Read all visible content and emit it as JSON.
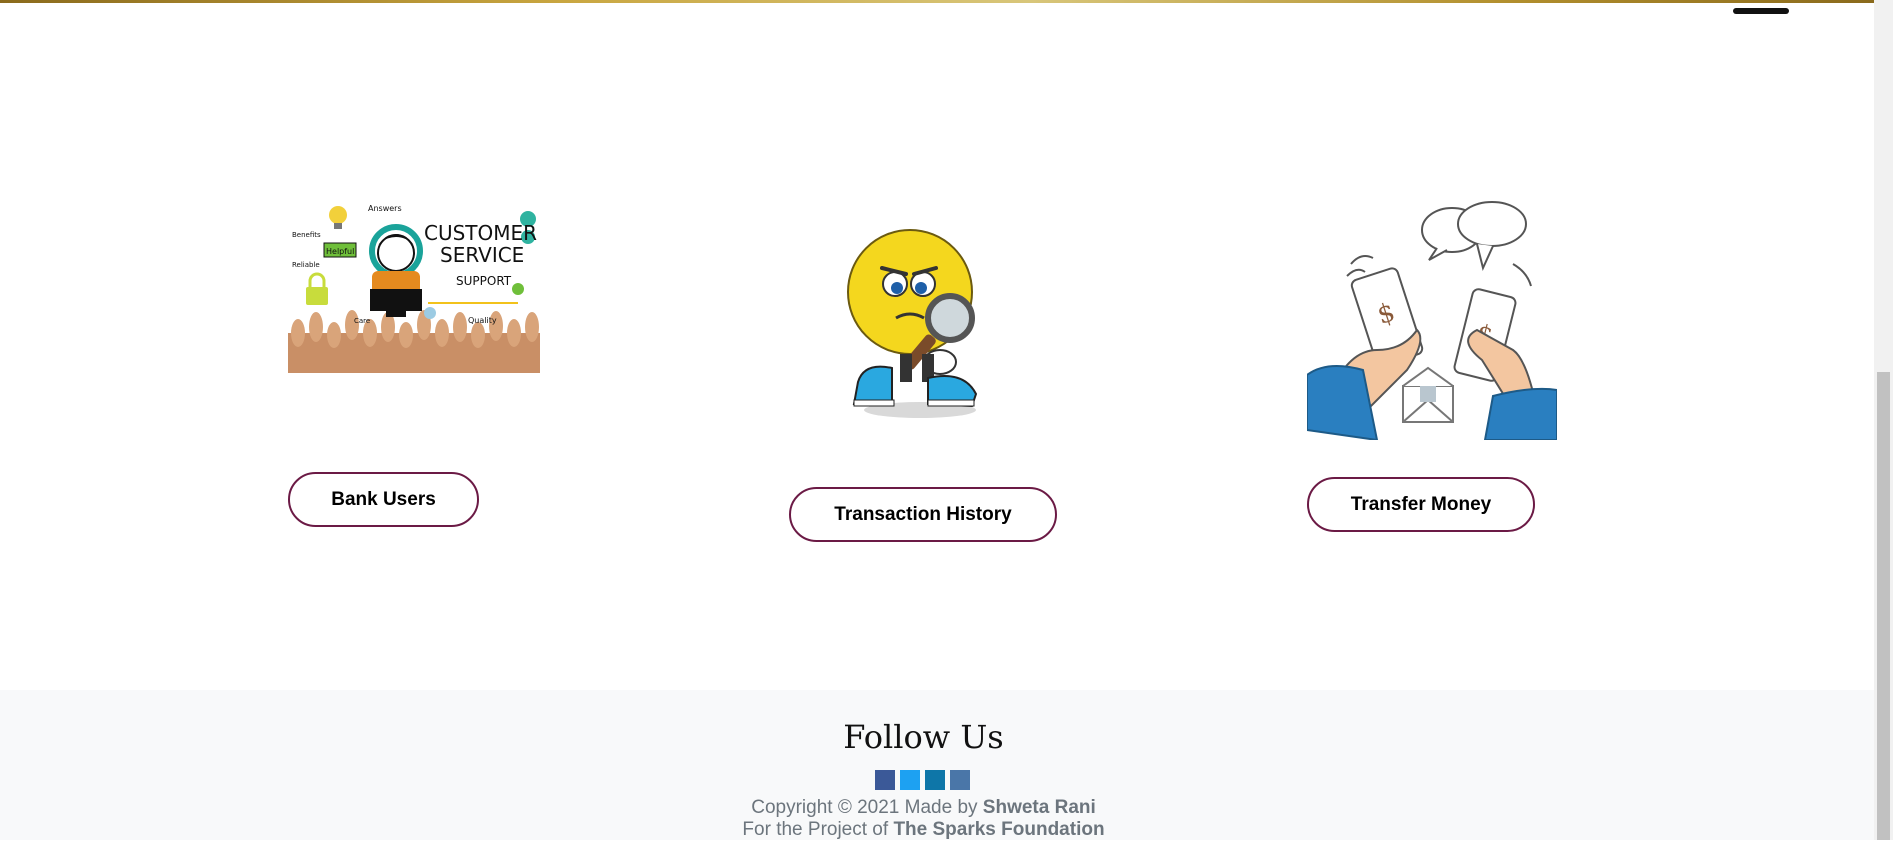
{
  "buttons": {
    "bank_users": "Bank Users",
    "transaction_history": "Transaction History",
    "transfer_money": "Transfer Money"
  },
  "images": {
    "customer_service": {
      "title": "CUSTOMER",
      "title2": "SERVICE",
      "subtitle": "SUPPORT",
      "words": [
        "Answers",
        "Helpful",
        "Quality",
        "Reliable",
        "Benefits",
        "Care"
      ]
    }
  },
  "footer": {
    "heading": "Follow Us",
    "social_icons": [
      "facebook-icon",
      "twitter-icon",
      "linkedin-icon",
      "tumblr-icon"
    ],
    "social_colors": [
      "#3b5998",
      "#1da1f2",
      "#0e76a8",
      "#4a76a8"
    ],
    "copyright_prefix": "Copyright © 2021 Made by",
    "author": "Shweta Rani",
    "project_prefix": "For the Project of",
    "organization": "The Sparks Foundation"
  },
  "colors": {
    "button_border": "#6b1a45",
    "footer_bg": "#f8f9fa",
    "muted_text": "#6c757d"
  }
}
